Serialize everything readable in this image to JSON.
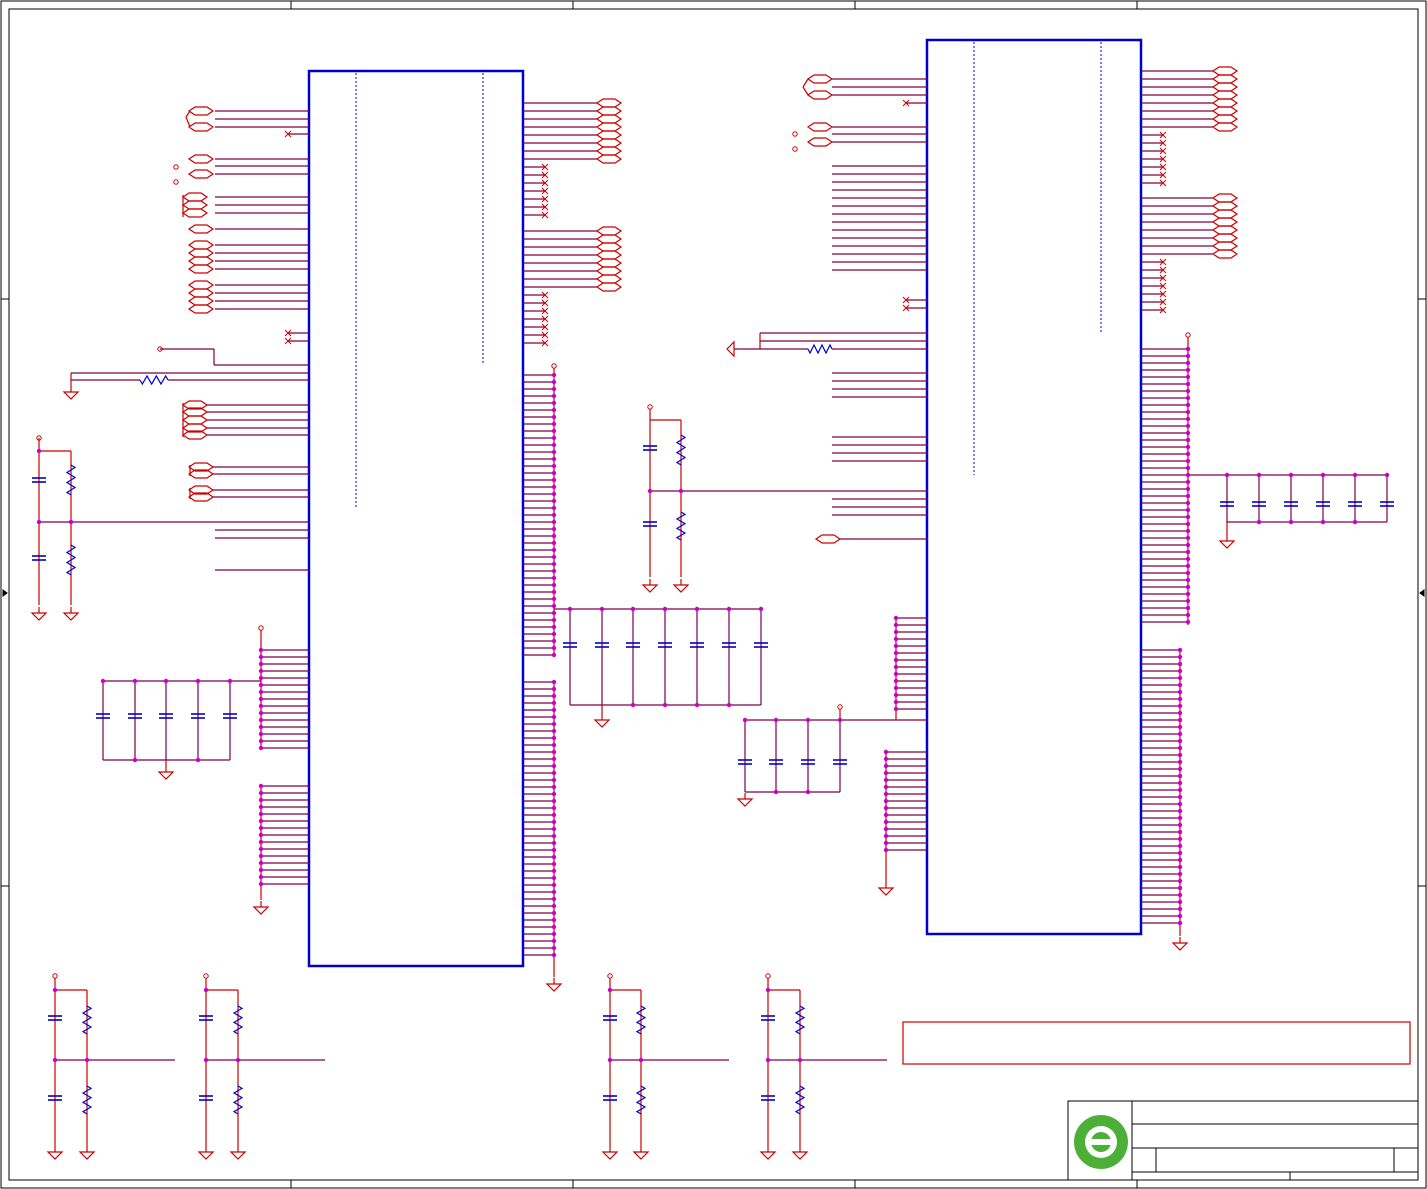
{
  "sheet": {
    "title": "",
    "note_box_text": "",
    "title_block": {
      "company_logo_letter": "e",
      "logo_color": "#4caf36",
      "rows": [
        "",
        "",
        ""
      ]
    }
  },
  "colors": {
    "wire": "#cc0000",
    "bus": "#7a0044",
    "component": "#0000cc",
    "junction": "#cc00cc",
    "frame": "#000000"
  },
  "symbols": {
    "ground": "ground-symbol",
    "power": "power-port",
    "resistor": "resistor-symbol",
    "capacitor": "capacitor-symbol",
    "port": "offsheet-port",
    "no_connect": "no-connect-marker"
  },
  "parts": [
    {
      "id": "U1",
      "type": "ic",
      "label": ""
    },
    {
      "id": "U2",
      "type": "ic",
      "label": ""
    }
  ]
}
